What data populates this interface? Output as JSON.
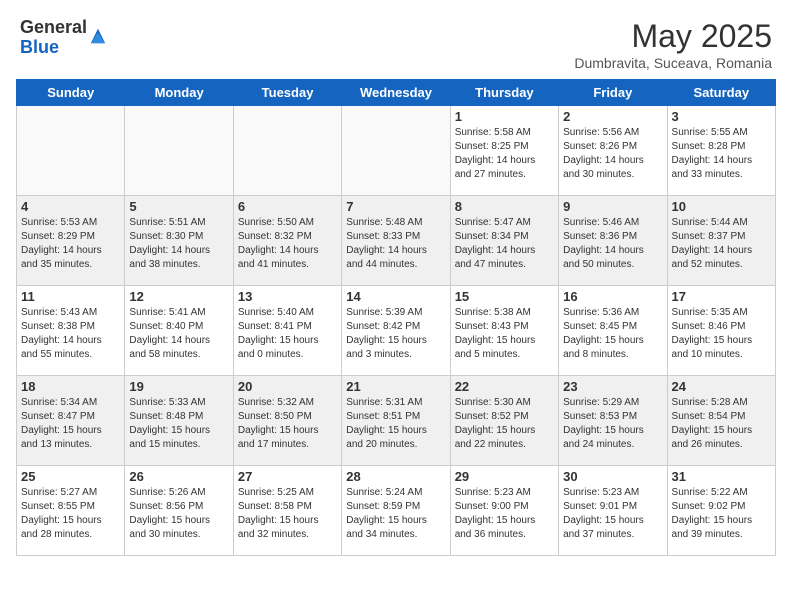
{
  "header": {
    "logo_general": "General",
    "logo_blue": "Blue",
    "title": "May 2025",
    "subtitle": "Dumbravita, Suceava, Romania"
  },
  "weekdays": [
    "Sunday",
    "Monday",
    "Tuesday",
    "Wednesday",
    "Thursday",
    "Friday",
    "Saturday"
  ],
  "weeks": [
    [
      {
        "num": "",
        "info": ""
      },
      {
        "num": "",
        "info": ""
      },
      {
        "num": "",
        "info": ""
      },
      {
        "num": "",
        "info": ""
      },
      {
        "num": "1",
        "info": "Sunrise: 5:58 AM\nSunset: 8:25 PM\nDaylight: 14 hours\nand 27 minutes."
      },
      {
        "num": "2",
        "info": "Sunrise: 5:56 AM\nSunset: 8:26 PM\nDaylight: 14 hours\nand 30 minutes."
      },
      {
        "num": "3",
        "info": "Sunrise: 5:55 AM\nSunset: 8:28 PM\nDaylight: 14 hours\nand 33 minutes."
      }
    ],
    [
      {
        "num": "4",
        "info": "Sunrise: 5:53 AM\nSunset: 8:29 PM\nDaylight: 14 hours\nand 35 minutes."
      },
      {
        "num": "5",
        "info": "Sunrise: 5:51 AM\nSunset: 8:30 PM\nDaylight: 14 hours\nand 38 minutes."
      },
      {
        "num": "6",
        "info": "Sunrise: 5:50 AM\nSunset: 8:32 PM\nDaylight: 14 hours\nand 41 minutes."
      },
      {
        "num": "7",
        "info": "Sunrise: 5:48 AM\nSunset: 8:33 PM\nDaylight: 14 hours\nand 44 minutes."
      },
      {
        "num": "8",
        "info": "Sunrise: 5:47 AM\nSunset: 8:34 PM\nDaylight: 14 hours\nand 47 minutes."
      },
      {
        "num": "9",
        "info": "Sunrise: 5:46 AM\nSunset: 8:36 PM\nDaylight: 14 hours\nand 50 minutes."
      },
      {
        "num": "10",
        "info": "Sunrise: 5:44 AM\nSunset: 8:37 PM\nDaylight: 14 hours\nand 52 minutes."
      }
    ],
    [
      {
        "num": "11",
        "info": "Sunrise: 5:43 AM\nSunset: 8:38 PM\nDaylight: 14 hours\nand 55 minutes."
      },
      {
        "num": "12",
        "info": "Sunrise: 5:41 AM\nSunset: 8:40 PM\nDaylight: 14 hours\nand 58 minutes."
      },
      {
        "num": "13",
        "info": "Sunrise: 5:40 AM\nSunset: 8:41 PM\nDaylight: 15 hours\nand 0 minutes."
      },
      {
        "num": "14",
        "info": "Sunrise: 5:39 AM\nSunset: 8:42 PM\nDaylight: 15 hours\nand 3 minutes."
      },
      {
        "num": "15",
        "info": "Sunrise: 5:38 AM\nSunset: 8:43 PM\nDaylight: 15 hours\nand 5 minutes."
      },
      {
        "num": "16",
        "info": "Sunrise: 5:36 AM\nSunset: 8:45 PM\nDaylight: 15 hours\nand 8 minutes."
      },
      {
        "num": "17",
        "info": "Sunrise: 5:35 AM\nSunset: 8:46 PM\nDaylight: 15 hours\nand 10 minutes."
      }
    ],
    [
      {
        "num": "18",
        "info": "Sunrise: 5:34 AM\nSunset: 8:47 PM\nDaylight: 15 hours\nand 13 minutes."
      },
      {
        "num": "19",
        "info": "Sunrise: 5:33 AM\nSunset: 8:48 PM\nDaylight: 15 hours\nand 15 minutes."
      },
      {
        "num": "20",
        "info": "Sunrise: 5:32 AM\nSunset: 8:50 PM\nDaylight: 15 hours\nand 17 minutes."
      },
      {
        "num": "21",
        "info": "Sunrise: 5:31 AM\nSunset: 8:51 PM\nDaylight: 15 hours\nand 20 minutes."
      },
      {
        "num": "22",
        "info": "Sunrise: 5:30 AM\nSunset: 8:52 PM\nDaylight: 15 hours\nand 22 minutes."
      },
      {
        "num": "23",
        "info": "Sunrise: 5:29 AM\nSunset: 8:53 PM\nDaylight: 15 hours\nand 24 minutes."
      },
      {
        "num": "24",
        "info": "Sunrise: 5:28 AM\nSunset: 8:54 PM\nDaylight: 15 hours\nand 26 minutes."
      }
    ],
    [
      {
        "num": "25",
        "info": "Sunrise: 5:27 AM\nSunset: 8:55 PM\nDaylight: 15 hours\nand 28 minutes."
      },
      {
        "num": "26",
        "info": "Sunrise: 5:26 AM\nSunset: 8:56 PM\nDaylight: 15 hours\nand 30 minutes."
      },
      {
        "num": "27",
        "info": "Sunrise: 5:25 AM\nSunset: 8:58 PM\nDaylight: 15 hours\nand 32 minutes."
      },
      {
        "num": "28",
        "info": "Sunrise: 5:24 AM\nSunset: 8:59 PM\nDaylight: 15 hours\nand 34 minutes."
      },
      {
        "num": "29",
        "info": "Sunrise: 5:23 AM\nSunset: 9:00 PM\nDaylight: 15 hours\nand 36 minutes."
      },
      {
        "num": "30",
        "info": "Sunrise: 5:23 AM\nSunset: 9:01 PM\nDaylight: 15 hours\nand 37 minutes."
      },
      {
        "num": "31",
        "info": "Sunrise: 5:22 AM\nSunset: 9:02 PM\nDaylight: 15 hours\nand 39 minutes."
      }
    ]
  ]
}
